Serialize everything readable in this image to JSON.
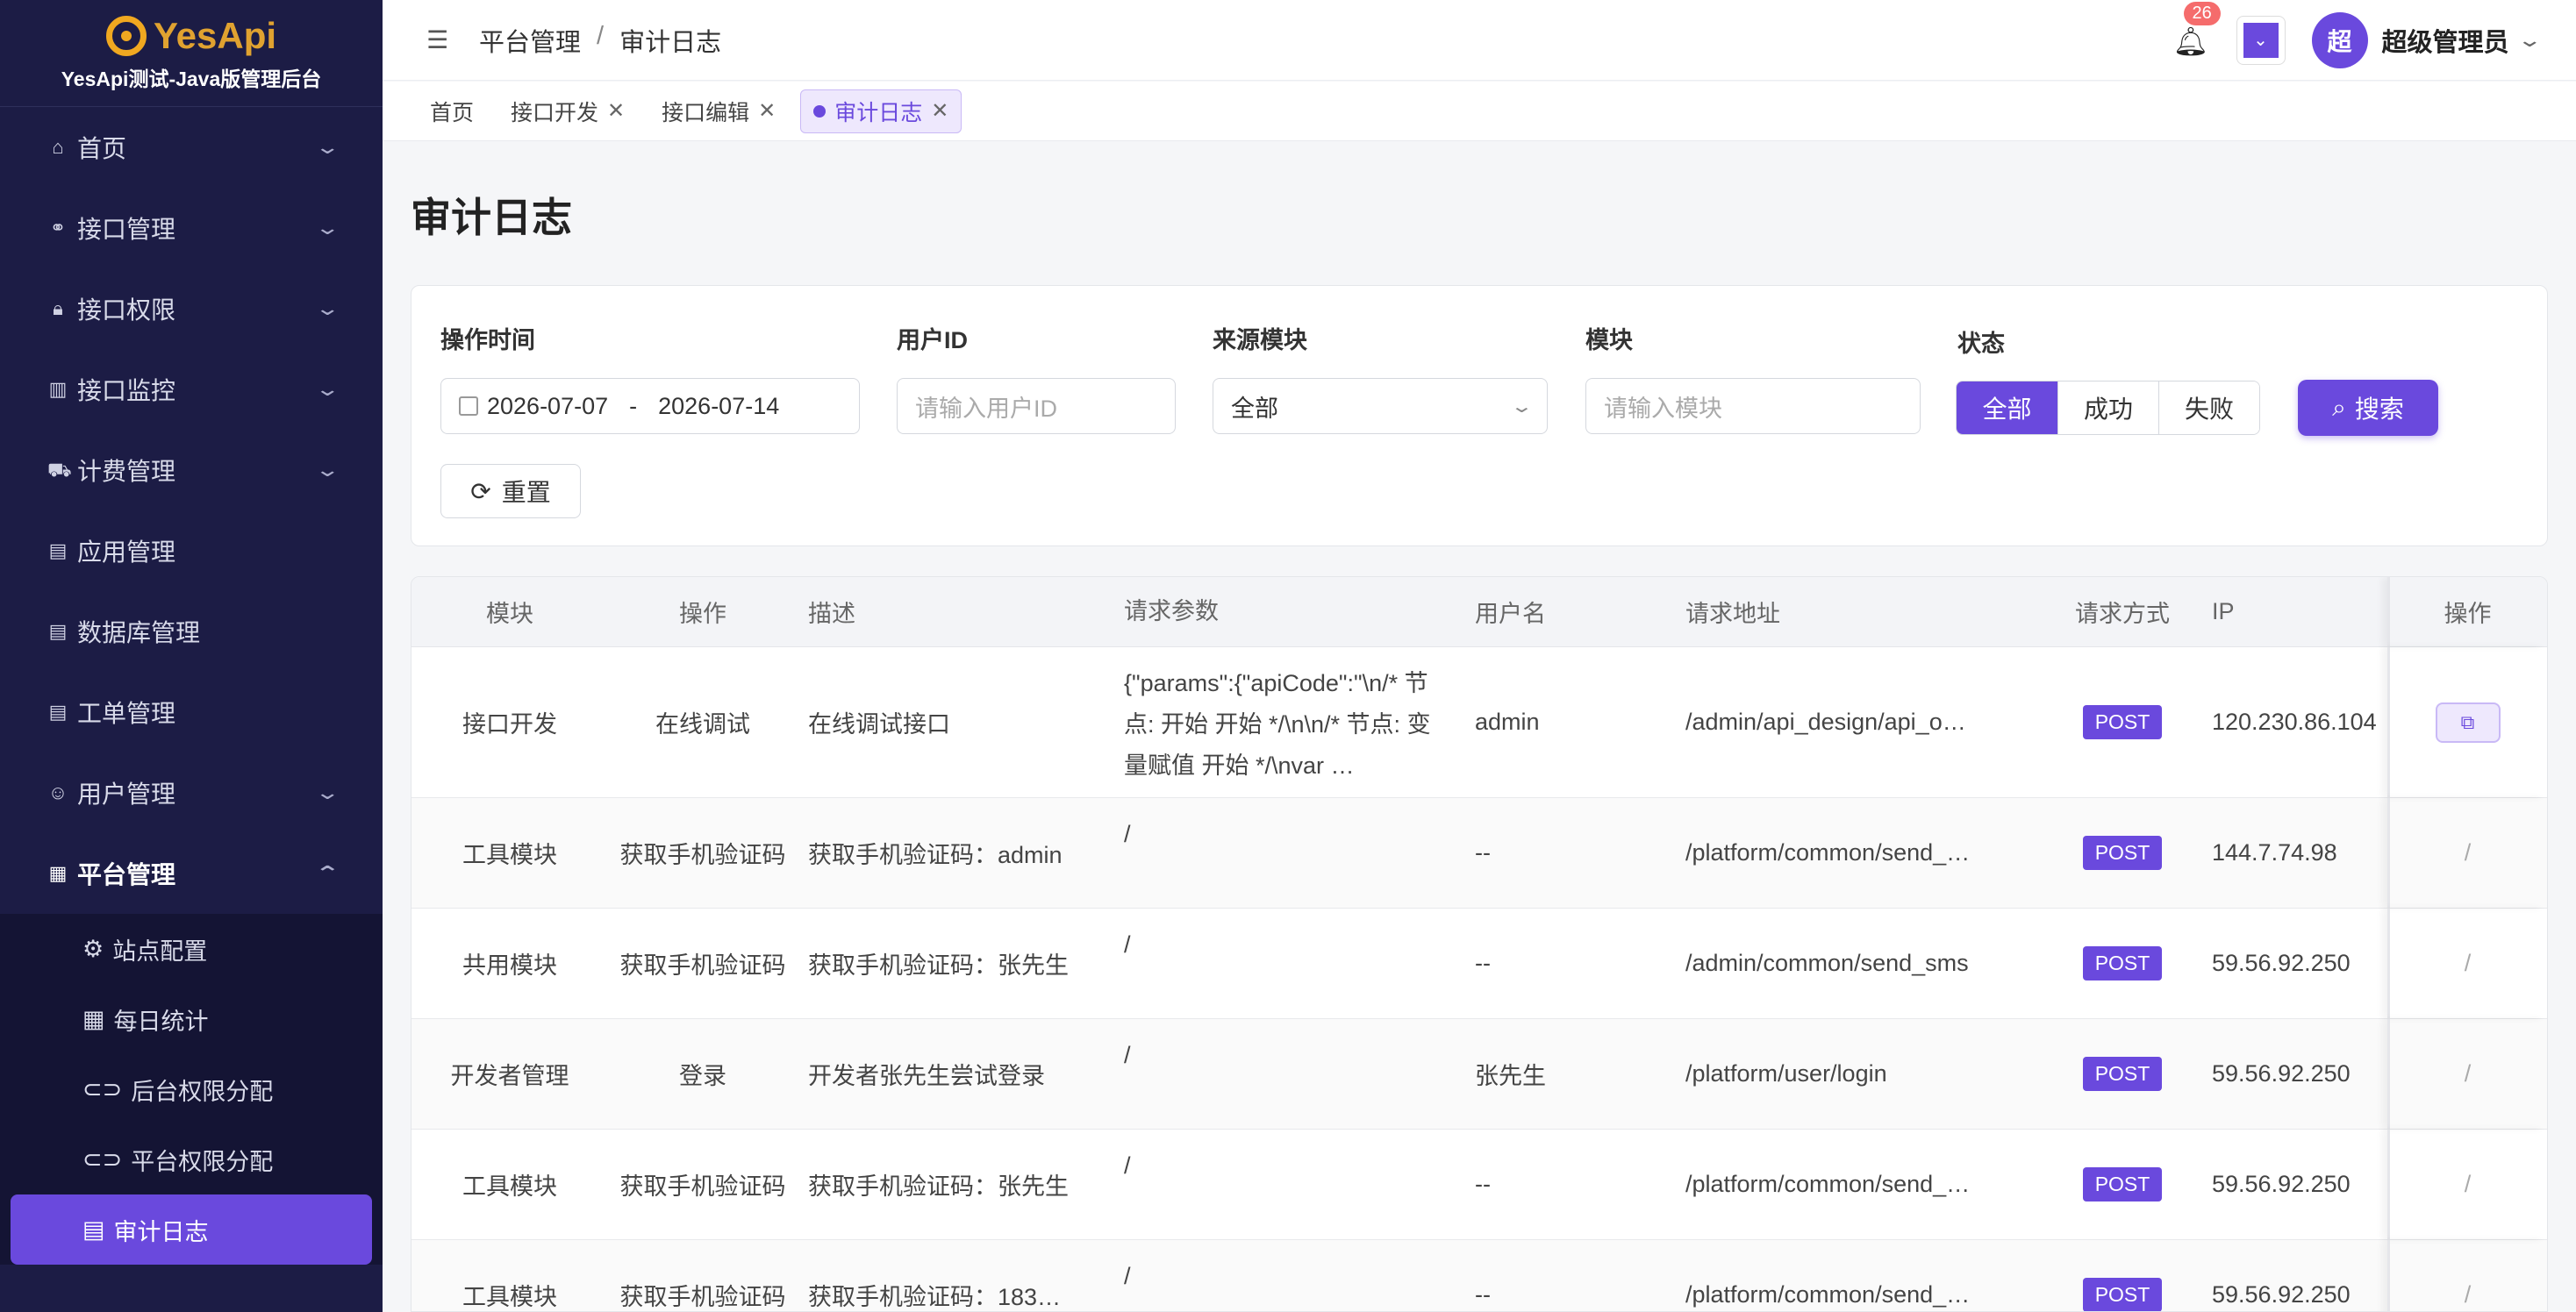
{
  "brand": {
    "logo_text": "YesApi",
    "subtitle": "YesApi测试-Java版管理后台"
  },
  "sidebar": {
    "items": [
      {
        "label": "首页",
        "icon": "home-icon"
      },
      {
        "label": "接口管理",
        "icon": "link-icon"
      },
      {
        "label": "接口权限",
        "icon": "lock-icon"
      },
      {
        "label": "接口监控",
        "icon": "bar-chart-icon"
      },
      {
        "label": "计费管理",
        "icon": "cart-icon"
      },
      {
        "label": "应用管理",
        "icon": "clipboard-icon"
      },
      {
        "label": "数据库管理",
        "icon": "clipboard-icon"
      },
      {
        "label": "工单管理",
        "icon": "clipboard-icon"
      },
      {
        "label": "用户管理",
        "icon": "user-icon"
      },
      {
        "label": "平台管理",
        "icon": "grid-icon"
      }
    ],
    "submenu": [
      {
        "label": "站点配置",
        "icon": "gear-icon"
      },
      {
        "label": "每日统计",
        "icon": "grid-icon"
      },
      {
        "label": "后台权限分配",
        "icon": "toggle-icon"
      },
      {
        "label": "平台权限分配",
        "icon": "toggle-icon"
      },
      {
        "label": "审计日志",
        "icon": "document-icon"
      }
    ]
  },
  "header": {
    "breadcrumb": [
      "平台管理",
      "审计日志"
    ],
    "breadcrumb_sep": "/",
    "notifications": "26",
    "avatar_char": "超",
    "username": "超级管理员"
  },
  "tabs": [
    {
      "label": "首页"
    },
    {
      "label": "接口开发"
    },
    {
      "label": "接口编辑"
    },
    {
      "label": "审计日志"
    }
  ],
  "page": {
    "title": "审计日志"
  },
  "filter": {
    "time_label": "操作时间",
    "date_start": "2026-07-07",
    "date_sep": "-",
    "date_end": "2026-07-14",
    "user_label": "用户ID",
    "user_placeholder": "请输入用户ID",
    "source_label": "来源模块",
    "source_value": "全部",
    "module_label": "模块",
    "module_placeholder": "请输入模块",
    "status_label": "状态",
    "status_options": [
      "全部",
      "成功",
      "失败"
    ],
    "search_label": "搜索",
    "reset_label": "重置"
  },
  "table": {
    "columns": [
      "模块",
      "操作",
      "描述",
      "请求参数",
      "用户名",
      "请求地址",
      "请求方式",
      "IP",
      "操作"
    ],
    "rows": [
      {
        "module": "接口开发",
        "action": "在线调试",
        "desc": "在线调试接口",
        "params": "{\"params\":{\"apiCode\":\"\\n/* 节点: 开始 开始 */\\n\\n/* 节点: 变量赋值 开始 */\\nvar …",
        "user": "admin",
        "url": "/admin/api_design/api_o…",
        "method": "POST",
        "ip": "120.230.86.104",
        "op": "copy"
      },
      {
        "module": "工具模块",
        "action": "获取手机验证码",
        "desc": "获取手机验证码：admin",
        "params": "/",
        "user": "--",
        "url": "/platform/common/send_…",
        "method": "POST",
        "ip": "144.7.74.98",
        "op": "/"
      },
      {
        "module": "共用模块",
        "action": "获取手机验证码",
        "desc": "获取手机验证码：张先生",
        "params": "/",
        "user": "--",
        "url": "/admin/common/send_sms",
        "method": "POST",
        "ip": "59.56.92.250",
        "op": "/"
      },
      {
        "module": "开发者管理",
        "action": "登录",
        "desc": "开发者张先生尝试登录",
        "params": "/",
        "user": "张先生",
        "url": "/platform/user/login",
        "method": "POST",
        "ip": "59.56.92.250",
        "op": "/"
      },
      {
        "module": "工具模块",
        "action": "获取手机验证码",
        "desc": "获取手机验证码：张先生",
        "params": "/",
        "user": "--",
        "url": "/platform/common/send_…",
        "method": "POST",
        "ip": "59.56.92.250",
        "op": "/"
      },
      {
        "module": "工具模块",
        "action": "获取手机验证码",
        "desc": "获取手机验证码：183…",
        "params": "/",
        "user": "--",
        "url": "/platform/common/send_…",
        "method": "POST",
        "ip": "59.56.92.250",
        "op": "/"
      }
    ]
  },
  "colors": {
    "accent": "#6a49dd",
    "sidebar_bg": "#1c1c45",
    "badge": "#f56c6c"
  }
}
